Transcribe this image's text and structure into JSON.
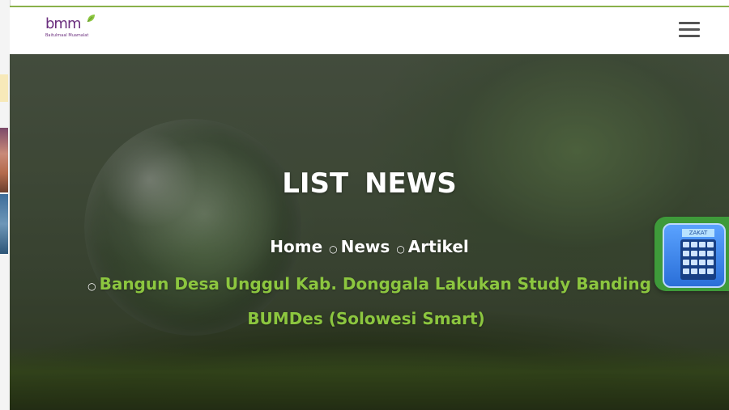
{
  "header": {
    "logo_text": "bmm",
    "logo_tagline": "Baitulmaal Muamalat",
    "menu_icon": "hamburger-icon"
  },
  "hero": {
    "title": "LIST  NEWS",
    "breadcrumb": [
      {
        "label": "Home"
      },
      {
        "label": "News"
      },
      {
        "label": "Artikel"
      }
    ],
    "current_article": "Bangun Desa Unggul Kab. Donggala Lakukan Study Banding BUMDes (Solowesi Smart)"
  },
  "widget": {
    "label": "ZAKAT",
    "icon": "calculator-icon"
  },
  "colors": {
    "accent_green": "#8cc63f",
    "header_border": "#8ab14a",
    "logo_purple": "#6b2f7e",
    "widget_green": "#3e9a3a",
    "widget_blue": "#2a6fd8"
  }
}
